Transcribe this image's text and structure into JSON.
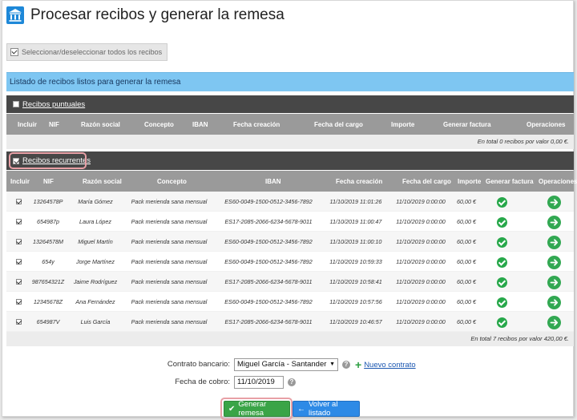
{
  "page": {
    "title": "Procesar recibos y generar la remesa",
    "select_all_label": "Seleccionar/deseleccionar todos los recibos",
    "list_header": "Listado de recibos listos para generar la remesa"
  },
  "puntuales": {
    "label": "Recibos puntuales",
    "checked": false,
    "columns": [
      "Incluir",
      "NIF",
      "Razón social",
      "Concepto",
      "IBAN",
      "Fecha creación",
      "Fecha del cargo",
      "Importe",
      "Generar factura",
      "Operaciones"
    ],
    "total": "En total 0 recibos por valor 0,00 €."
  },
  "recurrentes": {
    "label": "Recibos recurrentes",
    "checked": true,
    "columns": [
      "Incluir",
      "NIF",
      "Razón social",
      "Concepto",
      "IBAN",
      "Fecha creación",
      "Fecha del cargo",
      "Importe",
      "Generar factura",
      "Operaciones"
    ],
    "rows": [
      {
        "nif": "13264578P",
        "razon": "María Gómez",
        "concepto": "Pack merienda sana mensual",
        "iban": "ES60-0049-1500-0512-3456-7892",
        "creacion": "11/10/2019 11:01:26",
        "cargo": "11/10/2019 0:00:00",
        "importe": "60,00 €"
      },
      {
        "nif": "654987p",
        "razon": "Laura López",
        "concepto": "Pack merienda sana mensual",
        "iban": "ES17-2085-2066-6234-5678-9011",
        "creacion": "11/10/2019 11:00:47",
        "cargo": "11/10/2019 0:00:00",
        "importe": "60,00 €"
      },
      {
        "nif": "13264578M",
        "razon": "Miguel Martín",
        "concepto": "Pack merienda sana mensual",
        "iban": "ES60-0049-1500-0512-3456-7892",
        "creacion": "11/10/2019 11:00:10",
        "cargo": "11/10/2019 0:00:00",
        "importe": "60,00 €"
      },
      {
        "nif": "654y",
        "razon": "Jorge Martínez",
        "concepto": "Pack merienda sana mensual",
        "iban": "ES60-0049-1500-0512-3456-7892",
        "creacion": "11/10/2019 10:59:33",
        "cargo": "11/10/2019 0:00:00",
        "importe": "60,00 €"
      },
      {
        "nif": "987654321Z",
        "razon": "Jaime Rodríguez",
        "concepto": "Pack merienda sana mensual",
        "iban": "ES17-2085-2066-6234-5678-9011",
        "creacion": "11/10/2019 10:58:41",
        "cargo": "11/10/2019 0:00:00",
        "importe": "60,00 €"
      },
      {
        "nif": "12345678Z",
        "razon": "Ana Fernández",
        "concepto": "Pack merienda sana mensual",
        "iban": "ES60-0049-1500-0512-3456-7892",
        "creacion": "11/10/2019 10:57:56",
        "cargo": "11/10/2019 0:00:00",
        "importe": "60,00 €"
      },
      {
        "nif": "654987V",
        "razon": "Luis García",
        "concepto": "Pack merienda sana mensual",
        "iban": "ES17-2085-2066-6234-5678-9011",
        "creacion": "11/10/2019 10:46:57",
        "cargo": "11/10/2019 0:00:00",
        "importe": "60,00 €"
      }
    ],
    "total": "En total 7 recibos por valor 420,00 €."
  },
  "form": {
    "contract_label": "Contrato bancario:",
    "contract_value": "Miguel García - Santander",
    "new_contract": "Nuevo contrato",
    "date_label": "Fecha de cobro:",
    "date_value": "11/10/2019",
    "help_glyph": "?"
  },
  "buttons": {
    "generate": "Generar remesa",
    "back": "Volver al listado"
  },
  "colors": {
    "header_blue": "#7ec6f2",
    "section_dark": "#474747",
    "column_gray": "#9a9a9a",
    "success_green": "#27a84a",
    "button_blue": "#2d8ae6",
    "highlight": "#e8a0a6"
  },
  "icons": {
    "title": "bank-icon",
    "generate": "check-icon",
    "back": "arrow-left-icon",
    "operation": "arrow-right-circle-icon"
  }
}
